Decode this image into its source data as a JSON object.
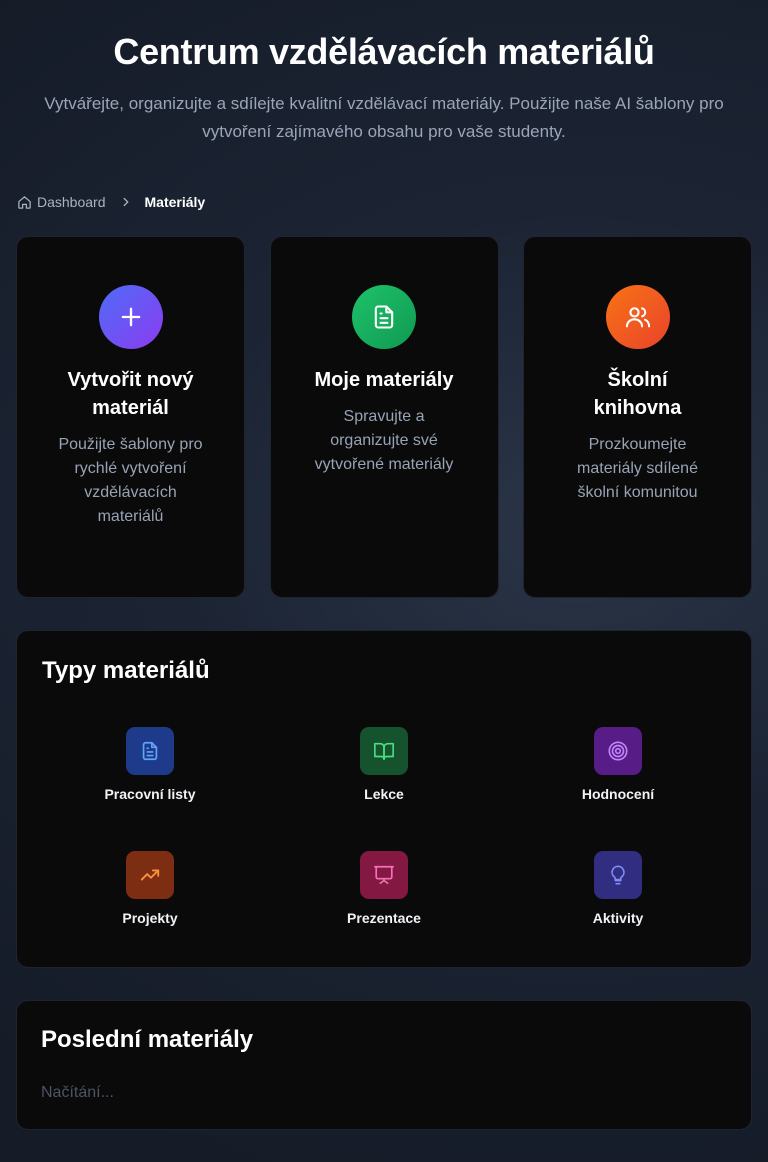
{
  "header": {
    "title": "Centrum vzdělávacích materiálů",
    "subtitle": "Vytvářejte, organizujte a sdílejte kvalitní vzdělávací materiály. Použijte naše AI šablony pro vytvoření zajímavého obsahu pro vaše studenty."
  },
  "breadcrumb": {
    "home": "Dashboard",
    "current": "Materiály"
  },
  "cards": [
    {
      "icon": "plus-icon",
      "title": "Vytvořit nový materiál",
      "description": "Použijte šablony pro rychlé vytvoření vzdělávacích materiálů"
    },
    {
      "icon": "document-icon",
      "title": "Moje materiály",
      "description": "Spravujte a organizujte své vytvořené materiály"
    },
    {
      "icon": "users-icon",
      "title": "Školní knihovna",
      "description": "Prozkoumejte materiály sdílené školní komunitou"
    }
  ],
  "types": {
    "title": "Typy materiálů",
    "items": [
      {
        "icon": "document-icon",
        "label": "Pracovní listy",
        "color": "#60a5fa"
      },
      {
        "icon": "book-open-icon",
        "label": "Lekce",
        "color": "#4ade80"
      },
      {
        "icon": "target-icon",
        "label": "Hodnocení",
        "color": "#c084fc"
      },
      {
        "icon": "trending-up-icon",
        "label": "Projekty",
        "color": "#fb923c"
      },
      {
        "icon": "presentation-icon",
        "label": "Prezentace",
        "color": "#f472b6"
      },
      {
        "icon": "lightbulb-icon",
        "label": "Aktivity",
        "color": "#818cf8"
      }
    ]
  },
  "recent": {
    "title": "Poslední materiály",
    "loading": "Načítání..."
  }
}
